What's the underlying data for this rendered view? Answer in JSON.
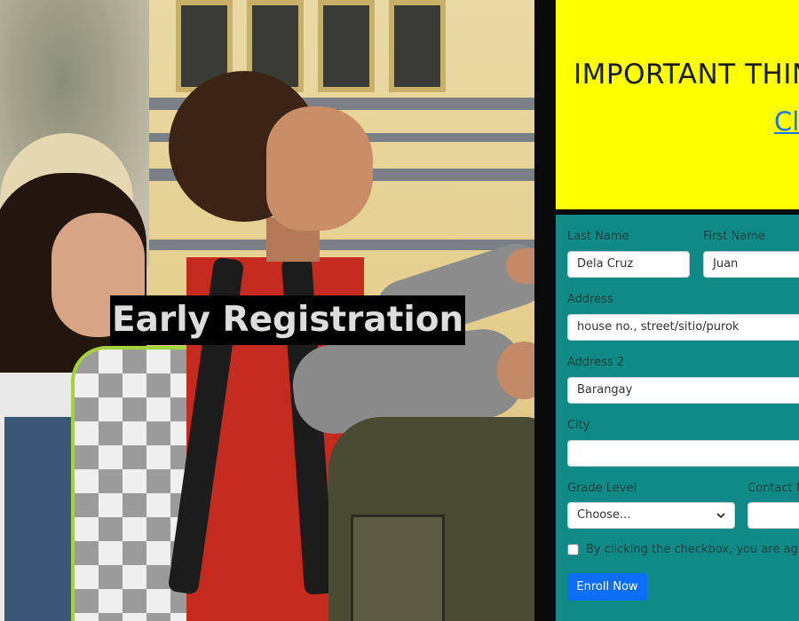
{
  "hero": {
    "title": "Early Registration"
  },
  "notice": {
    "title": "IMPORTANT THINGS TO KNOW",
    "link_text": "Click Here"
  },
  "form": {
    "last_name": {
      "label": "Last Name",
      "value": "Dela Cruz"
    },
    "first_name": {
      "label": "First Name",
      "value": "Juan"
    },
    "address": {
      "label": "Address",
      "placeholder": "house no., street/sitio/purok"
    },
    "address2": {
      "label": "Address 2",
      "placeholder": "Barangay"
    },
    "city": {
      "label": "City",
      "value": ""
    },
    "grade_level": {
      "label": "Grade Level",
      "selected": "Choose..."
    },
    "contact": {
      "label": "Contact No.",
      "value": ""
    },
    "agreement_text": "By clicking the checkbox, you are agreeing",
    "submit_label": "Enroll Now"
  },
  "colors": {
    "notice_bg": "#ffff00",
    "form_bg": "#0f8a86",
    "button_bg": "#0d6efd",
    "link": "#1a73e8"
  },
  "icons": [
    "chevron-down-icon"
  ]
}
